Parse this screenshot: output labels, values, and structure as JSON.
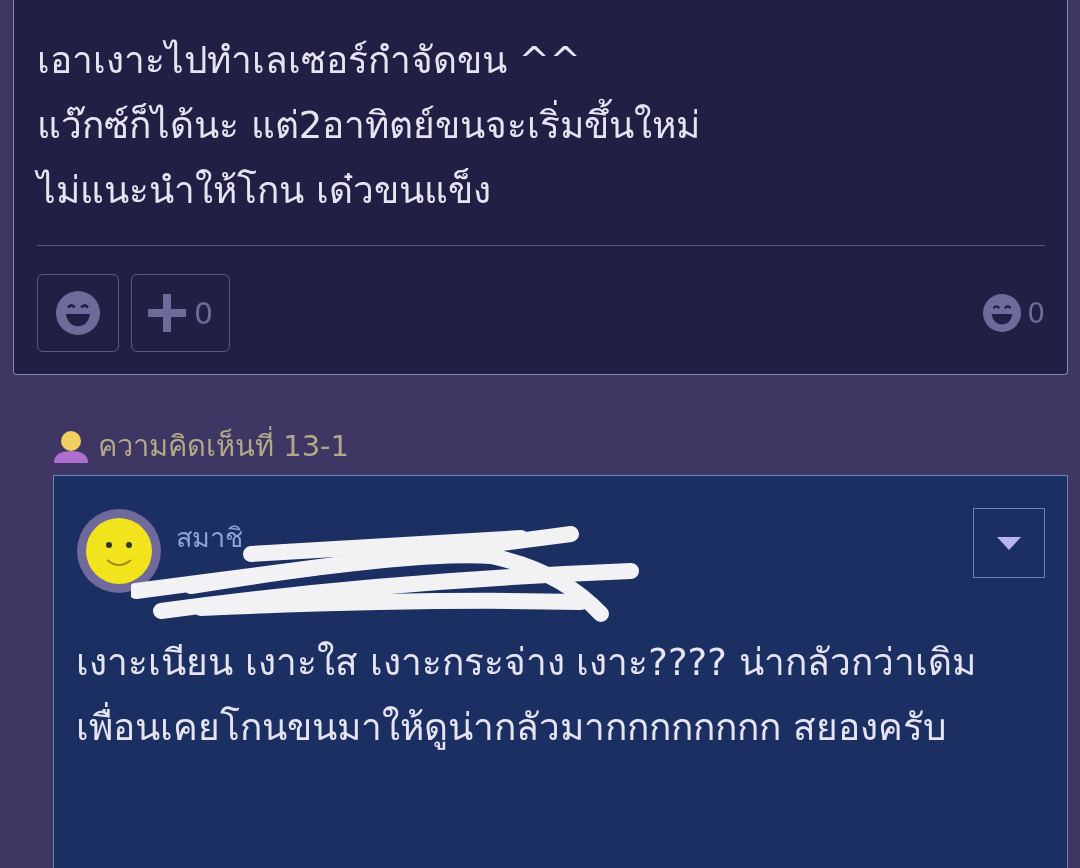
{
  "post": {
    "lines": [
      "เอาเงาะไปทำเลเซอร์กำจัดขน ^^",
      "แว๊กซ์ก็ได้นะ แต่2อาทิตย์ขนจะเริ่มขึ้นใหม่",
      "ไม่แนะนำให้โกน เด๋วขนแข็ง"
    ],
    "plus_count": "0",
    "reaction_count": "0"
  },
  "reply": {
    "label": "ความคิดเห็นที่ 13-1",
    "author": "สมาชิ",
    "redacted": true,
    "body": "เงาะเนียน เงาะใส เงาะกระจ่าง เงาะ???? น่ากลัวกว่าเดิม เพื่อนเคยโกนขนมาให้ดูน่ากลัวมากกกกกกกก สยองครับ"
  }
}
